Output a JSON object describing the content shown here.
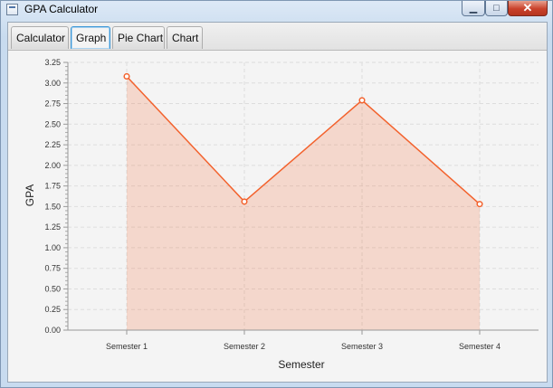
{
  "window": {
    "title": "GPA Calculator",
    "close_glyph": "✕",
    "min_glyph": "▁",
    "max_glyph": "□"
  },
  "tabs": [
    {
      "label": "Calculator",
      "active": false
    },
    {
      "label": "Graph",
      "active": true
    },
    {
      "label": "Pie Chart",
      "active": false
    },
    {
      "label": "Chart",
      "active": false
    }
  ],
  "colors": {
    "series": "#f3622d",
    "fill": "#f3622d",
    "grid": "#dddddd"
  },
  "chart_data": {
    "type": "area",
    "title": "",
    "xlabel": "Semester",
    "ylabel": "GPA",
    "categories": [
      "Semester 1",
      "Semester 2",
      "Semester 3",
      "Semester 4"
    ],
    "series": [
      {
        "values": [
          3.08,
          1.56,
          2.79,
          1.53
        ]
      }
    ],
    "ylim": [
      0,
      3.25
    ],
    "ytick_step": 0.25,
    "yticks": [
      "0.00",
      "0.25",
      "0.50",
      "0.75",
      "1.00",
      "1.25",
      "1.50",
      "1.75",
      "2.00",
      "2.25",
      "2.50",
      "2.75",
      "3.00",
      "3.25"
    ],
    "grid": true,
    "legend": "none"
  }
}
